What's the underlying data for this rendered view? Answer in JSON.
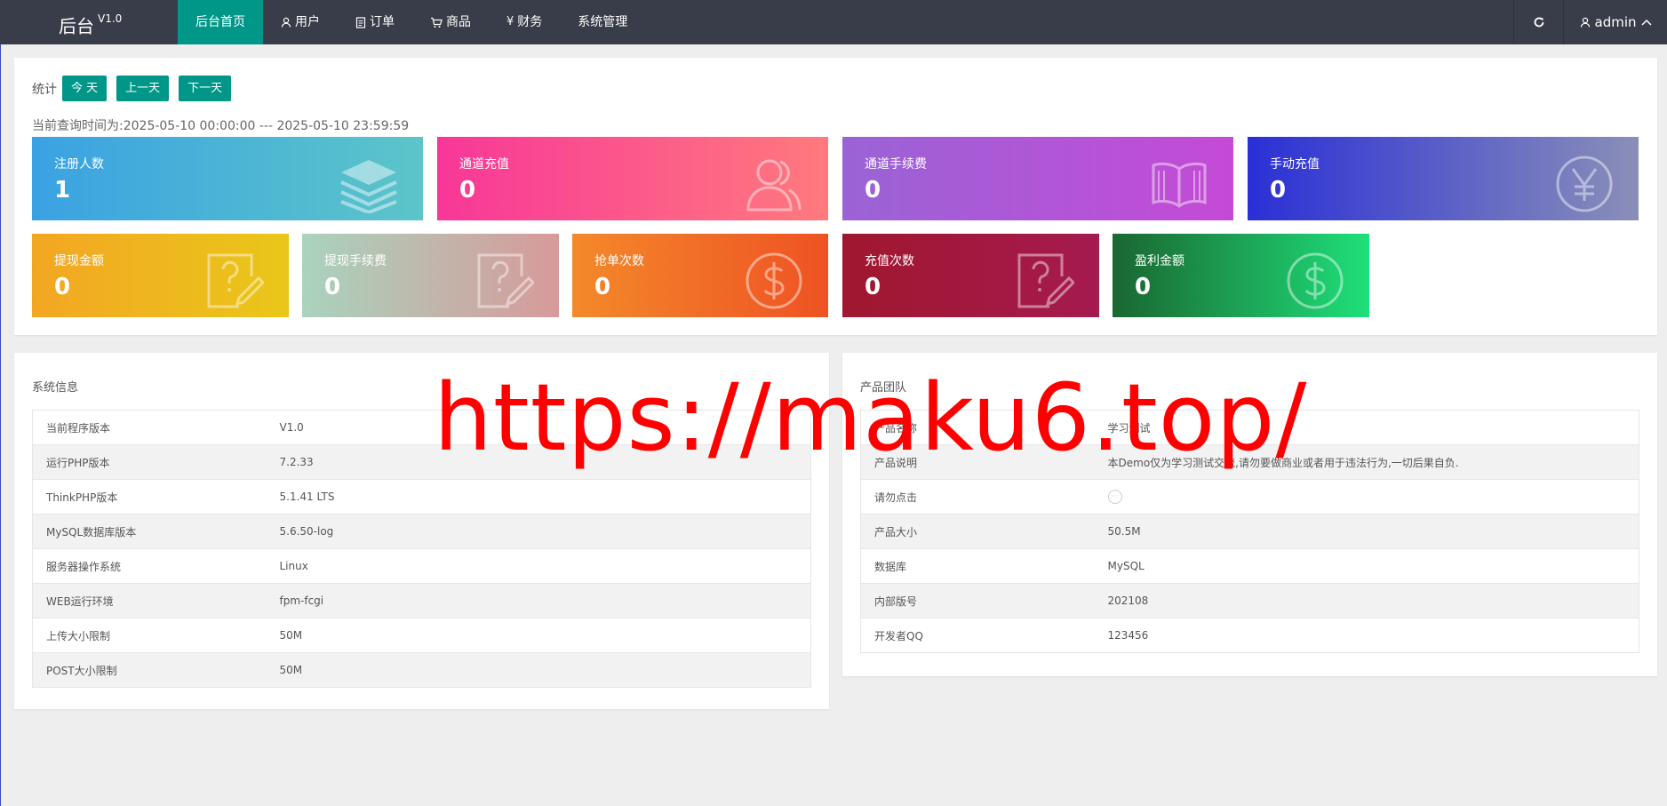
{
  "header": {
    "logo": "后台",
    "version": "V1.0",
    "nav": [
      {
        "label": "后台首页",
        "icon": ""
      },
      {
        "label": "用户",
        "icon": "user-icon"
      },
      {
        "label": "订单",
        "icon": "document-icon"
      },
      {
        "label": "商品",
        "icon": "cart-icon"
      },
      {
        "label": "财务",
        "icon": "yen-icon"
      },
      {
        "label": "系统管理",
        "icon": ""
      }
    ],
    "user": "admin"
  },
  "stats": {
    "label": "统计",
    "buttons": [
      "今 天",
      "上一天",
      "下一天"
    ],
    "query_range": "当前查询时间为:2025-05-10 00:00:00 --- 2025-05-10 23:59:59",
    "cards": [
      {
        "title": "注册人数",
        "value": "1",
        "icon": "layers-icon",
        "color_from": "#3aa2e2",
        "color_to": "#5cc5c9"
      },
      {
        "title": "通道充值",
        "value": "0",
        "icon": "users-icon",
        "color_from": "#f83798",
        "color_to": "#ff7a7d"
      },
      {
        "title": "通道手续费",
        "value": "0",
        "icon": "book-icon",
        "color_from": "#9a63d6",
        "color_to": "#c54ad6"
      },
      {
        "title": "手动充值",
        "value": "0",
        "icon": "yen-circle-icon",
        "color_from": "#2a2fd6",
        "color_to": "#8a8fb8"
      },
      {
        "title": "提现金额",
        "value": "0",
        "icon": "question-note-icon",
        "color_from": "#f3a623",
        "color_to": "#e9c719"
      },
      {
        "title": "提现手续费",
        "value": "0",
        "icon": "question-note-icon",
        "color_from": "#a9d3bd",
        "color_to": "#d79a9a"
      },
      {
        "title": "抢单次数",
        "value": "0",
        "icon": "dollar-circle-icon",
        "color_from": "#f4892a",
        "color_to": "#ee5224"
      },
      {
        "title": "充值次数",
        "value": "0",
        "icon": "question-note-icon",
        "color_from": "#a0172f",
        "color_to": "#a51a4f"
      },
      {
        "title": "盈利金额",
        "value": "0",
        "icon": "dollar-circle-icon",
        "color_from": "#1a6631",
        "color_to": "#1ee07a"
      }
    ]
  },
  "system_info": {
    "title": "系统信息",
    "rows": [
      [
        "当前程序版本",
        "V1.0"
      ],
      [
        "运行PHP版本",
        "7.2.33"
      ],
      [
        "ThinkPHP版本",
        "5.1.41 LTS"
      ],
      [
        "MySQL数据库版本",
        "5.6.50-log"
      ],
      [
        "服务器操作系统",
        "Linux"
      ],
      [
        "WEB运行环境",
        "fpm-fcgi"
      ],
      [
        "上传大小限制",
        "50M"
      ],
      [
        "POST大小限制",
        "50M"
      ]
    ]
  },
  "product_team": {
    "title": "产品团队",
    "rows": [
      [
        "产品名称",
        "学习测试"
      ],
      [
        "产品说明",
        "本Demo仅为学习测试交流,请勿要做商业或者用于违法行为,一切后果自负."
      ],
      [
        "请勿点击",
        ""
      ],
      [
        "产品大小",
        "50.5M"
      ],
      [
        "数据库",
        "MySQL"
      ],
      [
        "内部版号",
        "202108"
      ],
      [
        "开发者QQ",
        "123456"
      ]
    ]
  },
  "watermark": "https://maku6.top/"
}
